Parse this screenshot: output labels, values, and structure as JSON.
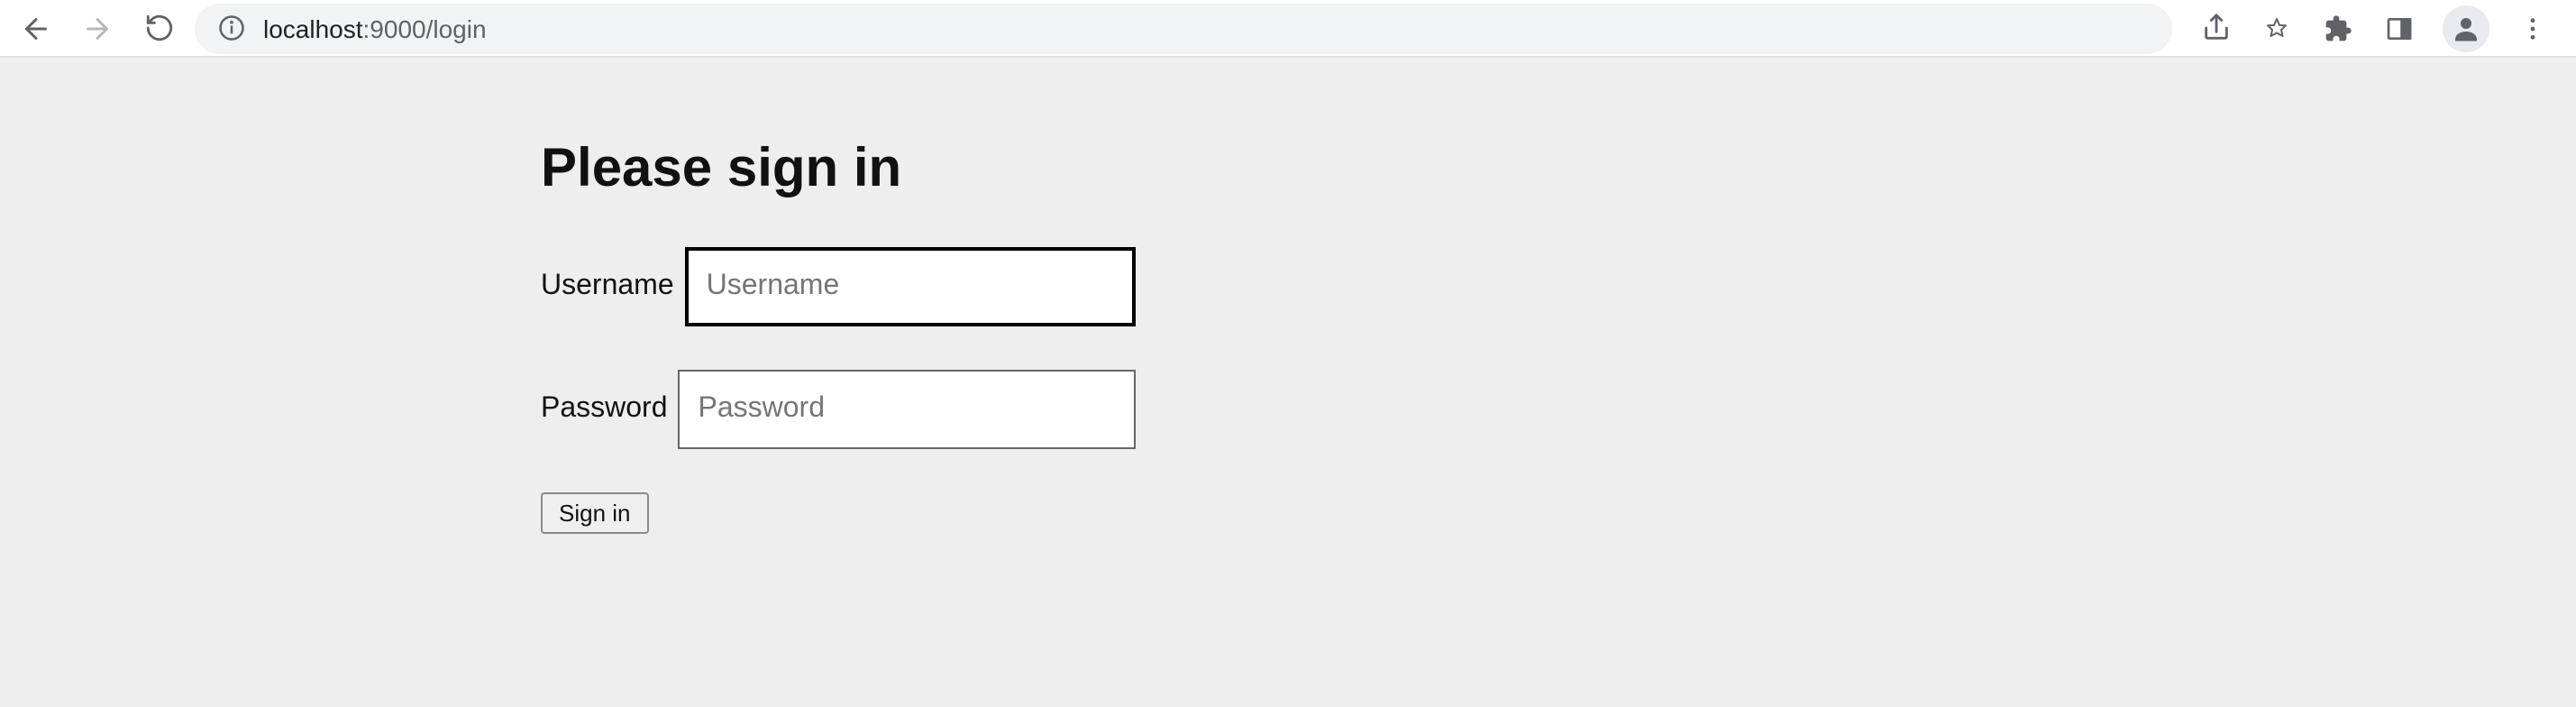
{
  "browser": {
    "url_host": "localhost",
    "url_port_path": ":9000/login"
  },
  "page": {
    "title": "Please sign in",
    "username_label": "Username",
    "username_placeholder": "Username",
    "password_label": "Password",
    "password_placeholder": "Password",
    "signin_label": "Sign in"
  }
}
